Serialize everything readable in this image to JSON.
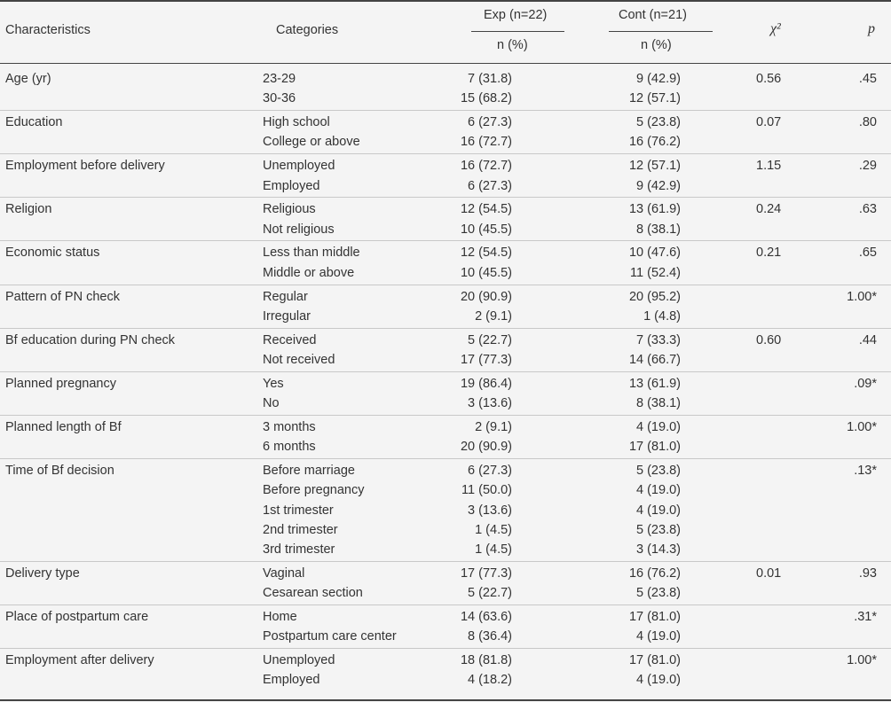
{
  "table": {
    "headers": {
      "characteristics": "Characteristics",
      "categories": "Categories",
      "exp": "Exp (n=22)",
      "cont": "Cont (n=21)",
      "exp_sub": "n (%)",
      "cont_sub": "n (%)",
      "chi": "χ²",
      "p": "p"
    },
    "groups": [
      {
        "characteristic": "Age (yr)",
        "chi": "0.56",
        "p": ".45",
        "rows": [
          {
            "category": "23-29",
            "exp": "7 (31.8)",
            "cont": "9 (42.9)"
          },
          {
            "category": "30-36",
            "exp": "15 (68.2)",
            "cont": "12 (57.1)"
          }
        ]
      },
      {
        "characteristic": "Education",
        "chi": "0.07",
        "p": ".80",
        "rows": [
          {
            "category": "High school",
            "exp": "6 (27.3)",
            "cont": "5 (23.8)"
          },
          {
            "category": "College or above",
            "exp": "16 (72.7)",
            "cont": "16 (76.2)"
          }
        ]
      },
      {
        "characteristic": "Employment before delivery",
        "chi": "1.15",
        "p": ".29",
        "rows": [
          {
            "category": "Unemployed",
            "exp": "16 (72.7)",
            "cont": "12 (57.1)"
          },
          {
            "category": "Employed",
            "exp": "6 (27.3)",
            "cont": "9 (42.9)"
          }
        ]
      },
      {
        "characteristic": "Religion",
        "chi": "0.24",
        "p": ".63",
        "rows": [
          {
            "category": "Religious",
            "exp": "12 (54.5)",
            "cont": "13 (61.9)"
          },
          {
            "category": "Not religious",
            "exp": "10 (45.5)",
            "cont": "8 (38.1)"
          }
        ]
      },
      {
        "characteristic": "Economic status",
        "chi": "0.21",
        "p": ".65",
        "rows": [
          {
            "category": "Less than middle",
            "exp": "12 (54.5)",
            "cont": "10 (47.6)"
          },
          {
            "category": "Middle or above",
            "exp": "10 (45.5)",
            "cont": "11 (52.4)"
          }
        ]
      },
      {
        "characteristic": "Pattern of PN check",
        "chi": "",
        "p": "1.00*",
        "rows": [
          {
            "category": "Regular",
            "exp": "20 (90.9)",
            "cont": "20 (95.2)"
          },
          {
            "category": "Irregular",
            "exp": "2 (9.1)",
            "cont": "1 (4.8)"
          }
        ]
      },
      {
        "characteristic": "Bf education during PN check",
        "chi": "0.60",
        "p": ".44",
        "rows": [
          {
            "category": "Received",
            "exp": "5 (22.7)",
            "cont": "7 (33.3)"
          },
          {
            "category": "Not received",
            "exp": "17 (77.3)",
            "cont": "14 (66.7)"
          }
        ]
      },
      {
        "characteristic": "Planned pregnancy",
        "chi": "",
        "p": ".09*",
        "rows": [
          {
            "category": "Yes",
            "exp": "19 (86.4)",
            "cont": "13 (61.9)"
          },
          {
            "category": "No",
            "exp": "3 (13.6)",
            "cont": "8 (38.1)"
          }
        ]
      },
      {
        "characteristic": "Planned length of Bf",
        "chi": "",
        "p": "1.00*",
        "rows": [
          {
            "category": "3 months",
            "exp": "2 (9.1)",
            "cont": "4 (19.0)"
          },
          {
            "category": "6 months",
            "exp": "20 (90.9)",
            "cont": "17 (81.0)"
          }
        ]
      },
      {
        "characteristic": "Time of Bf decision",
        "chi": "",
        "p": ".13*",
        "rows": [
          {
            "category": "Before marriage",
            "exp": "6 (27.3)",
            "cont": "5 (23.8)"
          },
          {
            "category": "Before pregnancy",
            "exp": "11 (50.0)",
            "cont": "4 (19.0)"
          },
          {
            "category": "1st trimester",
            "exp": "3 (13.6)",
            "cont": "4 (19.0)"
          },
          {
            "category": "2nd trimester",
            "exp": "1 (4.5)",
            "cont": "5 (23.8)"
          },
          {
            "category": "3rd trimester",
            "exp": "1 (4.5)",
            "cont": "3 (14.3)"
          }
        ]
      },
      {
        "characteristic": "Delivery type",
        "chi": "0.01",
        "p": ".93",
        "rows": [
          {
            "category": "Vaginal",
            "exp": "17 (77.3)",
            "cont": "16 (76.2)"
          },
          {
            "category": "Cesarean section",
            "exp": "5 (22.7)",
            "cont": "5 (23.8)"
          }
        ]
      },
      {
        "characteristic": "Place of postpartum care",
        "chi": "",
        "p": ".31*",
        "rows": [
          {
            "category": "Home",
            "exp": "14 (63.6)",
            "cont": "17 (81.0)"
          },
          {
            "category": "Postpartum care center",
            "exp": "8 (36.4)",
            "cont": "4 (19.0)"
          }
        ]
      },
      {
        "characteristic": "Employment after delivery",
        "chi": "",
        "p": "1.00*",
        "rows": [
          {
            "category": "Unemployed",
            "exp": "18 (81.8)",
            "cont": "17 (81.0)"
          },
          {
            "category": "Employed",
            "exp": "4 (18.2)",
            "cont": "4 (19.0)"
          }
        ]
      }
    ]
  }
}
